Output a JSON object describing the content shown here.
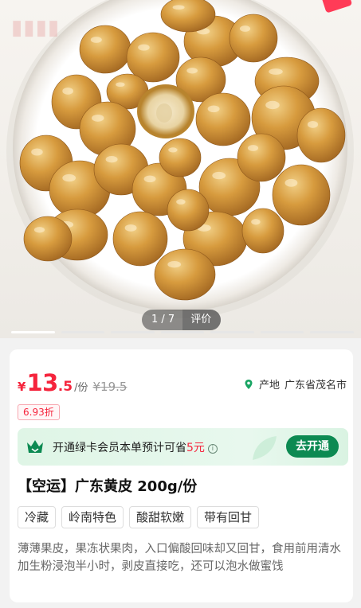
{
  "hero": {
    "pager_count": "1 / 7",
    "pager_review": "评价",
    "thumb_count": 7,
    "active_thumb": 1,
    "colors": {
      "plate": "#ffffff",
      "fruit": "#c9852a",
      "fruit_light": "#e6b155"
    }
  },
  "price": {
    "currency": "¥",
    "integer": "13",
    "decimal": ".5",
    "unit": "/份",
    "original": "¥19.5",
    "discount": "6.93折"
  },
  "origin": {
    "icon": "location-pin-icon",
    "label": "产地",
    "value": "广东省茂名市"
  },
  "member": {
    "icon": "crown-icon",
    "text_prefix": "开通绿卡会员本单预计可省",
    "save_amount": "5元",
    "info_icon": "info-icon",
    "button": "去开通"
  },
  "product": {
    "title": "【空运】广东黄皮 200g/份",
    "tags": [
      "冷藏",
      "岭南特色",
      "酸甜软嫩",
      "带有回甘"
    ],
    "description": "薄薄果皮，果冻状果肉，入口偏酸回味却又回甘，食用前用清水加生粉浸泡半小时，剥皮直接吃，还可以泡水做蜜饯"
  },
  "colors": {
    "accent": "#f5243c",
    "brand_green": "#0c8a52"
  }
}
